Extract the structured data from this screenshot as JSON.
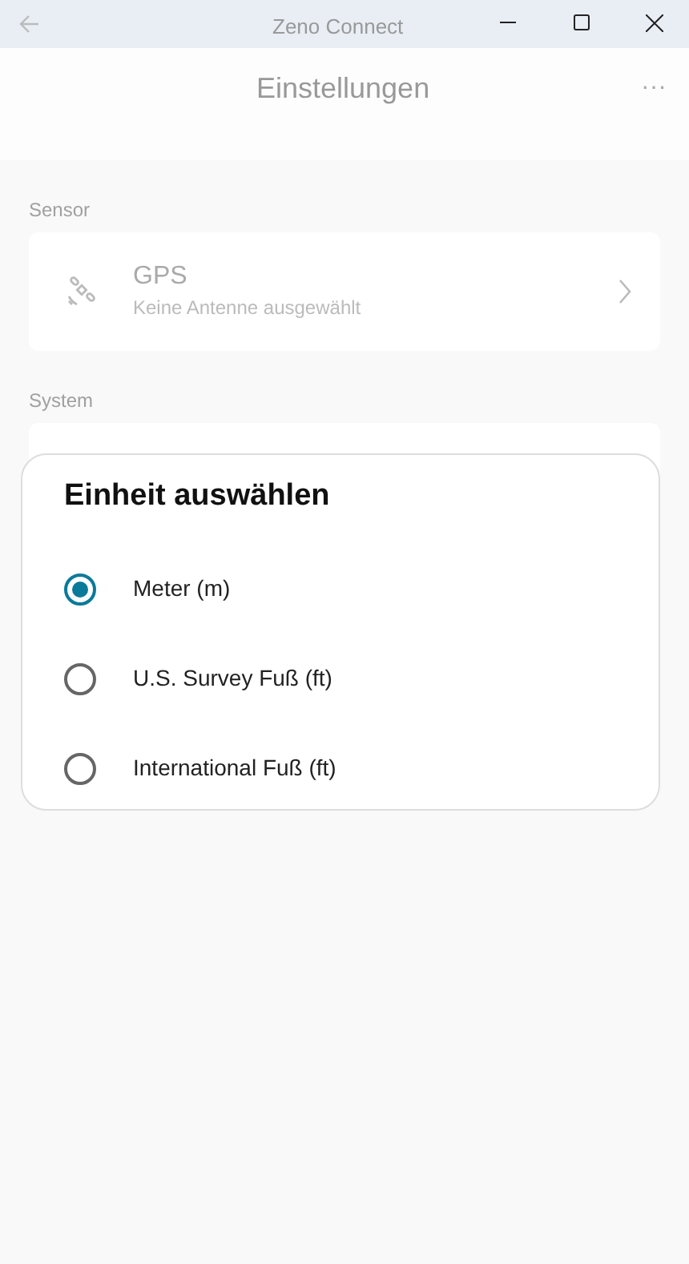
{
  "window": {
    "title": "Zeno Connect"
  },
  "header": {
    "title": "Einstellungen",
    "menu": "···"
  },
  "sections": [
    {
      "label": "Sensor",
      "items": [
        {
          "title": "GPS",
          "subtitle": "Keine Antenne ausgewählt"
        }
      ]
    },
    {
      "label": "System"
    }
  ],
  "dialog": {
    "title": "Einheit auswählen",
    "options": [
      {
        "label": "Meter (m)",
        "selected": true
      },
      {
        "label": "U.S. Survey Fuß (ft)",
        "selected": false
      },
      {
        "label": "International Fuß (ft)",
        "selected": false
      }
    ]
  }
}
